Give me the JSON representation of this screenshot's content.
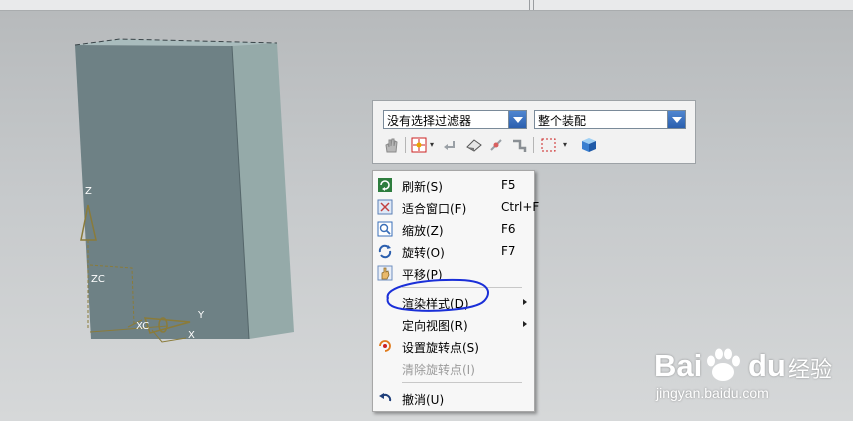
{
  "window": {
    "toolbar": {
      "filter_combo": {
        "value": "没有选择过滤器"
      },
      "scope_combo": {
        "value": "整个装配"
      },
      "icons": [
        "hand-select-icon",
        "type-filter-icon",
        "undo-arrow-icon",
        "eraser-icon",
        "point-snap-icon",
        "link-icon",
        "box-select-icon",
        "solid-cube-icon"
      ]
    },
    "context_menu": {
      "items": [
        {
          "label": "刷新(S)",
          "shortcut": "F5",
          "icon": "refresh-icon",
          "enabled": true
        },
        {
          "label": "适合窗口(F)",
          "shortcut": "Ctrl+F",
          "icon": "fit-window-icon",
          "enabled": true
        },
        {
          "label": "缩放(Z)",
          "shortcut": "F6",
          "icon": "zoom-icon",
          "enabled": true
        },
        {
          "label": "旋转(O)",
          "shortcut": "F7",
          "icon": "rotate-icon",
          "enabled": true
        },
        {
          "label": "平移(P)",
          "shortcut": "",
          "icon": "pan-icon",
          "enabled": true
        },
        {
          "label": "渲染样式(D)",
          "shortcut": "",
          "icon": "",
          "enabled": true,
          "submenu": true
        },
        {
          "label": "定向视图(R)",
          "shortcut": "",
          "icon": "",
          "enabled": true,
          "submenu": true
        },
        {
          "label": "设置旋转点(S)",
          "shortcut": "",
          "icon": "set-rotate-point-icon",
          "enabled": true
        },
        {
          "label": "清除旋转点(I)",
          "shortcut": "",
          "icon": "",
          "enabled": false
        },
        {
          "label": "撤消(U)",
          "shortcut": "",
          "icon": "undo-icon",
          "enabled": true
        }
      ]
    },
    "axes": {
      "z_label": "Z",
      "zc_label": "ZC",
      "xc_label": "XC",
      "y_label": "Y",
      "x_label": "X"
    }
  },
  "annotation": {
    "color": "#1a2fd8"
  },
  "watermark": {
    "brand_bai": "Bai",
    "brand_du": "du",
    "brand_jingyan": "经验",
    "url": "jingyan.baidu.com"
  },
  "colors": {
    "viewport_bg": "#c6c9cb",
    "model_front": "#6e8185",
    "model_side": "#95aaa9",
    "model_top": "#a9bcbd",
    "accent_blue": "#2b5fae"
  }
}
